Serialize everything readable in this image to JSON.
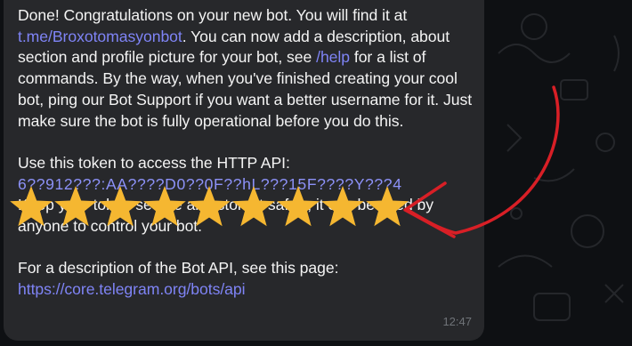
{
  "message": {
    "intro_part1": "Done! Congratulations on your new bot. You will find it at",
    "bot_link": "t.me/Broxotomasyonbot",
    "intro_part2": ". You can now add a description, about section and profile picture for your bot, see",
    "help_link": "/help",
    "intro_part3": "for a list of commands. By the way, when you've finished creating your cool bot, ping our Bot Support if you want a better username for it. Just make sure the bot is fully operational before you do this.",
    "token_label": "Use this token to access the HTTP API:",
    "token_value": "6?​?912???:AA????D0??0F??hL???15F????Y???4",
    "warning": "Keep your token secure and store it safely, it can be used by anyone to control your bot.",
    "api_label": "For a description of the Bot API, see this page:",
    "api_link": "https://core.telegram.org/bots/api",
    "time": "12:47"
  },
  "annotation": {
    "star_count": 9,
    "star_color": "#f5b731",
    "arrow_color": "#d81f26"
  },
  "colors": {
    "bubble": "#27282b",
    "text": "#f4f4f4",
    "link": "#7f84f6",
    "background": "#0e1013"
  }
}
